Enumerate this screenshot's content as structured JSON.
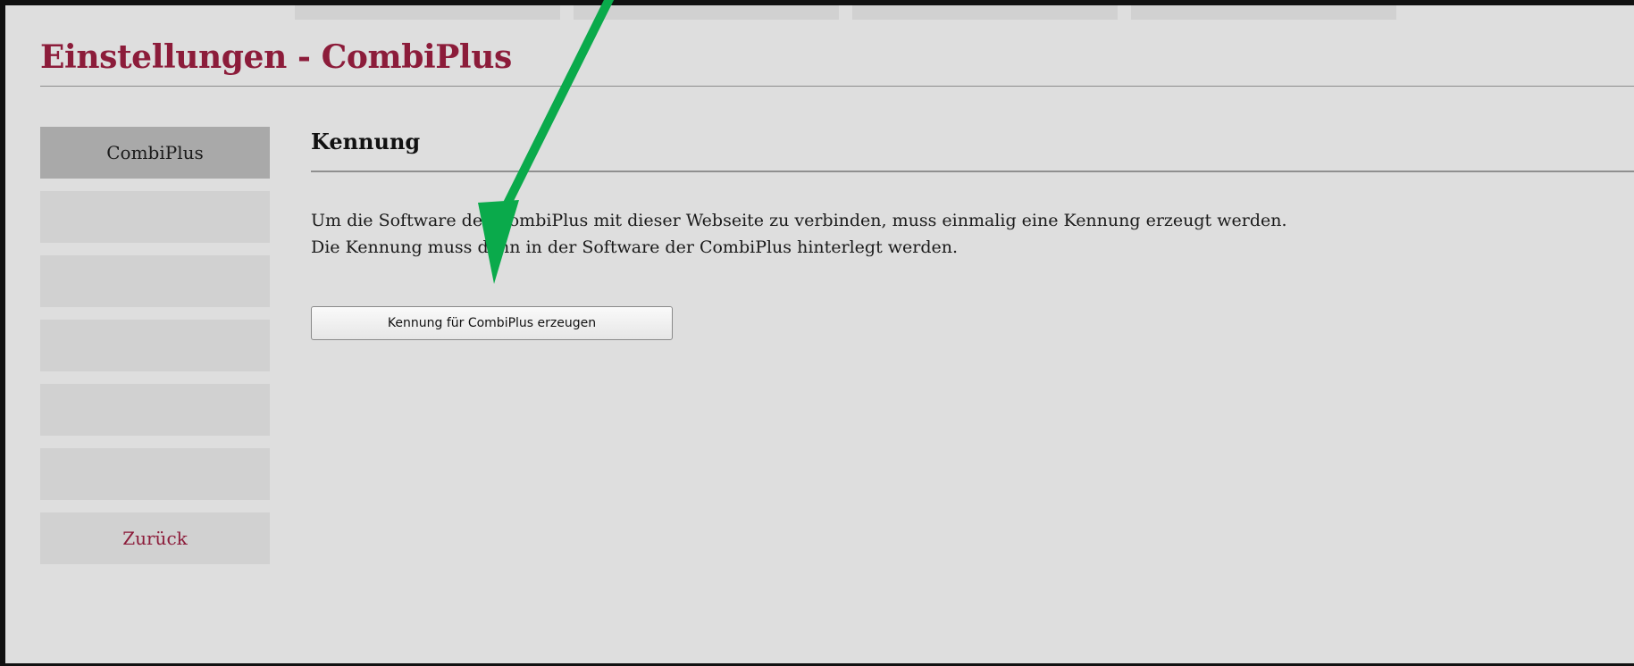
{
  "page": {
    "title": "Einstellungen - CombiPlus"
  },
  "sidebar": {
    "items": [
      {
        "label": "CombiPlus",
        "active": true
      },
      {
        "label": ""
      },
      {
        "label": ""
      },
      {
        "label": ""
      },
      {
        "label": ""
      },
      {
        "label": ""
      },
      {
        "label": "Zurück"
      }
    ]
  },
  "section": {
    "heading": "Kennung",
    "paragraph1": "Um die Software der CombiPlus mit dieser Webseite zu verbinden, muss einmalig eine Kennung erzeugt werden.",
    "paragraph2": "Die Kennung muss dann in der Software der CombiPlus hinterlegt werden.",
    "button_label": "Kennung für CombiPlus erzeugen"
  },
  "colors": {
    "title": "#8c1c3a",
    "background": "#dedede",
    "nav_active": "#a9a9a9",
    "nav_item": "#d1d1d1",
    "annotation_arrow": "#0aaa4b"
  },
  "annotation": {
    "icon": "arrow-down-left-icon"
  }
}
